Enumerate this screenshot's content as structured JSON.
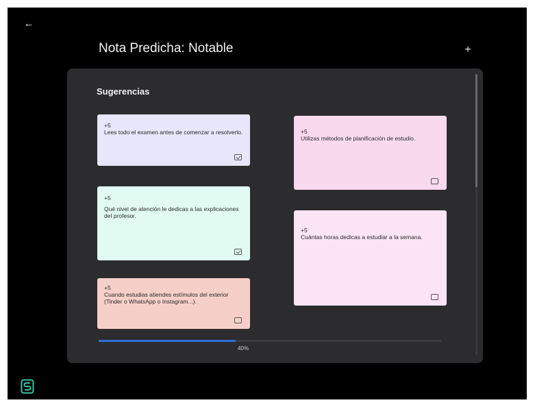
{
  "header": {
    "back_icon": "arrow-left-icon",
    "title": "Nota Predicha: Notable",
    "add_icon": "plus-icon"
  },
  "panel": {
    "title": "Sugerencias",
    "cards": [
      {
        "points": "+5",
        "text": "Lees todo el examen antes de comenzar a resolverlo.",
        "checked": true,
        "color": "#e7e6fb"
      },
      {
        "points": "+5",
        "text": "Utilizas métodos de planificación de estudio.",
        "checked": false,
        "color": "#f9d9ee"
      },
      {
        "points": "+5",
        "text": "Qué nivel de atención le dedicas a las explicaciones del profesor.",
        "checked": true,
        "color": "#e1fbf2"
      },
      {
        "points": "+5",
        "text": "Cuántas horas dedicas a estudiar a la semana.",
        "checked": false,
        "color": "#fbe4f4"
      },
      {
        "points": "+5",
        "text": "Cuando estudias atiendes estímulos del exterior (Tinder o WhatsApp o Instagram...).",
        "checked": false,
        "color": "#f7cfc9"
      }
    ],
    "progress": {
      "percent": 40,
      "label": "40%",
      "color": "#2f6fd8"
    }
  },
  "logo_icon": "app-logo-icon",
  "colors": {
    "background": "#000000",
    "panel": "#2c2c2e",
    "logo": "#33c4a6"
  }
}
